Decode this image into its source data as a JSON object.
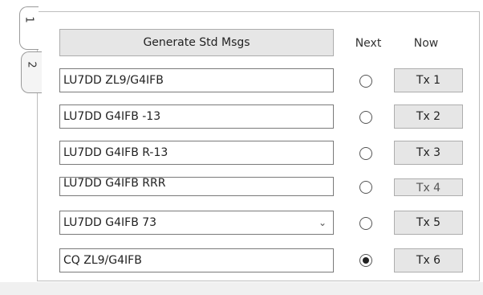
{
  "tabs": [
    {
      "label": "1",
      "active": true
    },
    {
      "label": "2",
      "active": false
    }
  ],
  "generate_label": "Generate Std Msgs",
  "col_next": "Next",
  "col_now": "Now",
  "messages": [
    {
      "text": "LU7DD ZL9/G4IFB",
      "selected": false,
      "tx_label": "Tx 1"
    },
    {
      "text": "LU7DD G4IFB -13",
      "selected": false,
      "tx_label": "Tx 2"
    },
    {
      "text": "LU7DD G4IFB R-13",
      "selected": false,
      "tx_label": "Tx 3"
    },
    {
      "text": "LU7DD G4IFB RRR",
      "selected": false,
      "tx_label": "Tx 4"
    },
    {
      "text": "LU7DD G4IFB 73",
      "selected": false,
      "tx_label": "Tx 5",
      "has_dropdown": true
    },
    {
      "text": "CQ ZL9/G4IFB",
      "selected": true,
      "tx_label": "Tx 6"
    }
  ]
}
